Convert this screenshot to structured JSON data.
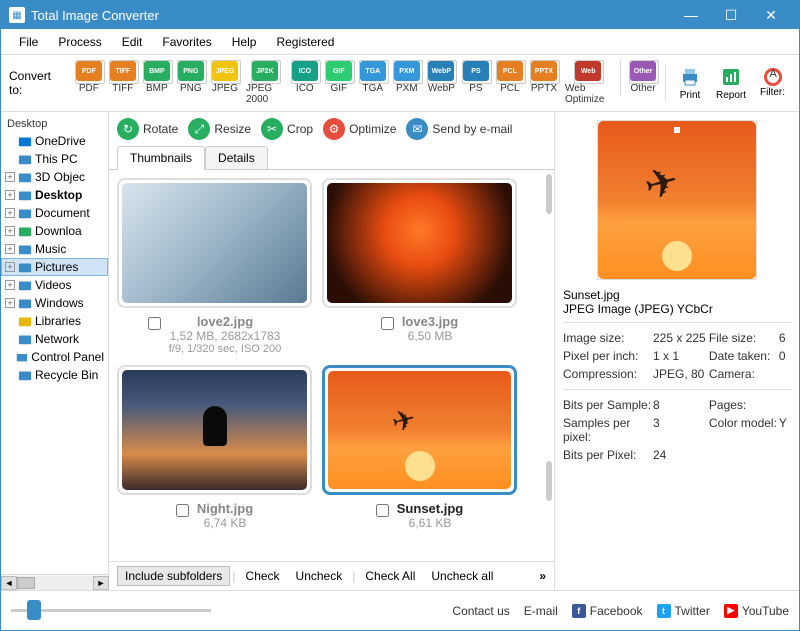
{
  "app": {
    "title": "Total Image Converter"
  },
  "menu": {
    "items": [
      "File",
      "Process",
      "Edit",
      "Favorites",
      "Help",
      "Registered"
    ]
  },
  "toolbar": {
    "convert_label": "Convert to:",
    "formats": [
      {
        "code": "PDF",
        "label": "PDF",
        "color": "#e67e22"
      },
      {
        "code": "TIFF",
        "label": "TIFF",
        "color": "#e67e22"
      },
      {
        "code": "BMP",
        "label": "BMP",
        "color": "#27ae60"
      },
      {
        "code": "PNG",
        "label": "PNG",
        "color": "#27ae60"
      },
      {
        "code": "JPEG",
        "label": "JPEG",
        "color": "#f1c40f"
      },
      {
        "code": "JP2K",
        "label": "JPEG 2000",
        "color": "#27ae60"
      },
      {
        "code": "ICO",
        "label": "ICO",
        "color": "#16a085"
      },
      {
        "code": "GIF",
        "label": "GIF",
        "color": "#2ecc71"
      },
      {
        "code": "TGA",
        "label": "TGA",
        "color": "#3498db"
      },
      {
        "code": "PXM",
        "label": "PXM",
        "color": "#3498db"
      },
      {
        "code": "WebP",
        "label": "WebP",
        "color": "#2980b9"
      },
      {
        "code": "PS",
        "label": "PS",
        "color": "#2980b9"
      },
      {
        "code": "PCL",
        "label": "PCL",
        "color": "#e67e22"
      },
      {
        "code": "PPTX",
        "label": "PPTX",
        "color": "#e67e22"
      },
      {
        "code": "Web",
        "label": "Web Optimize",
        "color": "#c0392b"
      },
      {
        "code": "Other",
        "label": "Other",
        "color": "#9b59b6"
      }
    ],
    "print": "Print",
    "report": "Report",
    "filter": "Filter:"
  },
  "sidebar": {
    "label": "Desktop",
    "items": [
      {
        "label": "OneDrive",
        "icon": "cloud",
        "color": "#0078d4"
      },
      {
        "label": "This PC",
        "icon": "pc",
        "color": "#3a8cc7"
      },
      {
        "label": "3D Objec",
        "icon": "3d",
        "color": "#3a8cc7",
        "exp": true
      },
      {
        "label": "Desktop",
        "icon": "desktop",
        "color": "#3a8cc7",
        "exp": true,
        "bold": true
      },
      {
        "label": "Document",
        "icon": "doc",
        "color": "#3a8cc7",
        "exp": true
      },
      {
        "label": "Downloa",
        "icon": "down",
        "color": "#27ae60",
        "exp": true
      },
      {
        "label": "Music",
        "icon": "music",
        "color": "#3a8cc7",
        "exp": true
      },
      {
        "label": "Pictures",
        "icon": "pic",
        "color": "#3a8cc7",
        "exp": true,
        "selected": true
      },
      {
        "label": "Videos",
        "icon": "video",
        "color": "#3a8cc7",
        "exp": true
      },
      {
        "label": "Windows",
        "icon": "win",
        "color": "#3a8cc7",
        "exp": true
      },
      {
        "label": "Libraries",
        "icon": "lib",
        "color": "#e6b800"
      },
      {
        "label": "Network",
        "icon": "net",
        "color": "#3a8cc7"
      },
      {
        "label": "Control Panel",
        "icon": "ctrl",
        "color": "#3a8cc7"
      },
      {
        "label": "Recycle Bin",
        "icon": "bin",
        "color": "#3a8cc7"
      }
    ]
  },
  "actions": {
    "rotate": "Rotate",
    "resize": "Resize",
    "crop": "Crop",
    "optimize": "Optimize",
    "send": "Send by e-mail"
  },
  "tabs": {
    "thumbnails": "Thumbnails",
    "details": "Details"
  },
  "thumbs": [
    {
      "name": "love2.jpg",
      "size": "1,52 MB, 2682x1783",
      "extra": "f/9, 1/320 sec, ISO 200",
      "img": "img-love2"
    },
    {
      "name": "love3.jpg",
      "size": "6,50 MB",
      "img": "img-love3"
    },
    {
      "name": "Night.jpg",
      "size": "6,74 KB",
      "img": "img-night"
    },
    {
      "name": "Sunset.jpg",
      "size": "6,61 KB",
      "img": "img-sunset",
      "selected": true
    }
  ],
  "bottom": {
    "items": [
      "Include subfolders",
      "Check",
      "Uncheck",
      "Check All",
      "Uncheck all"
    ]
  },
  "preview": {
    "filename": "Sunset.jpg",
    "type": "JPEG Image (JPEG) YCbCr",
    "rows1": [
      {
        "l1": "Image size:",
        "v1": "225 x 225",
        "l2": "File size:",
        "v2": "6"
      },
      {
        "l1": "Pixel per inch:",
        "v1": "1 x 1",
        "l2": "Date taken:",
        "v2": "0"
      },
      {
        "l1": "Compression:",
        "v1": "JPEG, 80",
        "l2": "Camera:",
        "v2": ""
      }
    ],
    "rows2": [
      {
        "l1": "Bits per Sample:",
        "v1": "8",
        "l2": "Pages:",
        "v2": ""
      },
      {
        "l1": "Samples per pixel:",
        "v1": "3",
        "l2": "Color model:",
        "v2": "Y"
      },
      {
        "l1": "Bits per Pixel:",
        "v1": "24",
        "l2": "",
        "v2": ""
      }
    ]
  },
  "footer": {
    "contact": "Contact us",
    "email": "E-mail",
    "facebook": "Facebook",
    "twitter": "Twitter",
    "youtube": "YouTube"
  }
}
